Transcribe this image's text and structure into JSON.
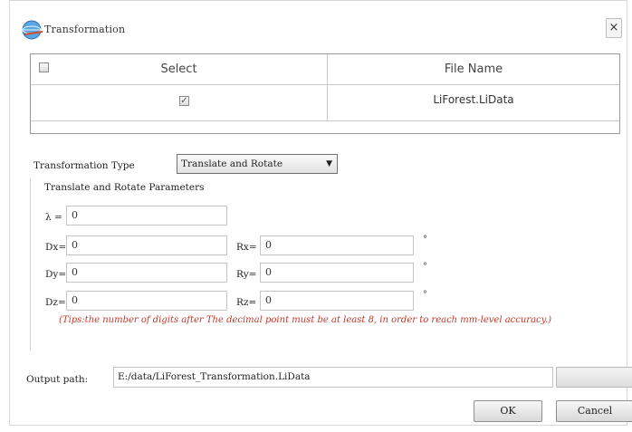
{
  "window": {
    "title": "Transformation",
    "close_glyph": "×"
  },
  "grid": {
    "headers": {
      "select": "Select",
      "file_name": "File Name"
    },
    "rows": [
      {
        "checked": true,
        "file_name": "LiForest.LiData"
      }
    ]
  },
  "transformation_type": {
    "label": "Transformation Type",
    "value": "Translate and Rotate"
  },
  "parameters": {
    "group_title": "Translate and Rotate Parameters",
    "lambda": {
      "label": "λ =",
      "value": "0"
    },
    "dx": {
      "label": "Dx=",
      "value": "0"
    },
    "dy": {
      "label": "Dy=",
      "value": "0"
    },
    "dz": {
      "label": "Dz=",
      "value": "0"
    },
    "rx": {
      "label": "Rx=",
      "value": "0"
    },
    "ry": {
      "label": "Ry=",
      "value": "0"
    },
    "rz": {
      "label": "Rz=",
      "value": "0"
    },
    "degree_symbol": "°",
    "tip": "(Tips:the number of digits after The decimal point must be at least 8, in order to reach mm-level accuracy.)"
  },
  "output": {
    "label": "Output path:",
    "value": "E:/data/LiForest_Transformation.LiData",
    "browse_label": ""
  },
  "buttons": {
    "ok": "OK",
    "cancel": "Cancel"
  },
  "colors": {
    "tip": "#c0392b",
    "border": "#9a9a9a"
  }
}
